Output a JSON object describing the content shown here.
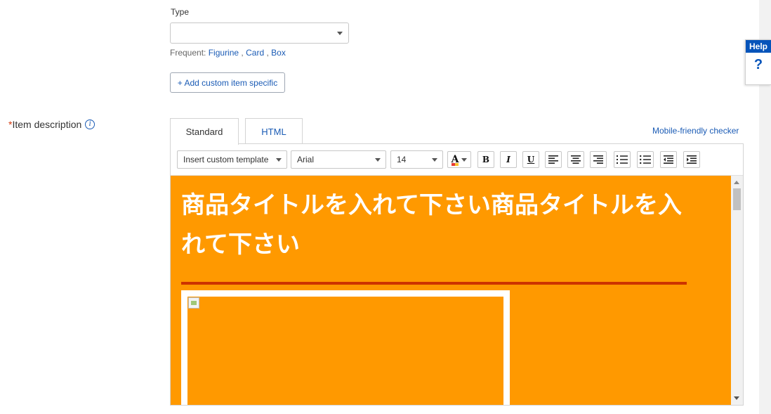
{
  "type_field": {
    "label": "Type",
    "value": "",
    "frequent_prefix": "Frequent:",
    "frequent": [
      "Figurine",
      "Card",
      "Box"
    ],
    "separator": ","
  },
  "add_custom_button": "+ Add custom item specific",
  "item_description": {
    "required_marker": "*",
    "label": "Item description",
    "info_icon": "i"
  },
  "tabs": [
    {
      "label": "Standard",
      "active": true
    },
    {
      "label": "HTML",
      "active": false
    }
  ],
  "mobile_checker_link": "Mobile-friendly checker",
  "toolbar": {
    "template_select": "Insert custom template",
    "font_select": "Arial",
    "size_select": "14",
    "font_color_icon": "A",
    "bold": "B",
    "italic": "I",
    "underline": "U"
  },
  "content": {
    "title": "商品タイトルを入れて下さい商品タイトルを入れて下さい"
  },
  "help": {
    "label": "Help",
    "icon": "?"
  },
  "colors": {
    "content_bg": "#ff9900",
    "rule": "#cc3300",
    "link": "#1a5bb5",
    "help_blue": "#0654ba",
    "required": "#d4380d"
  }
}
